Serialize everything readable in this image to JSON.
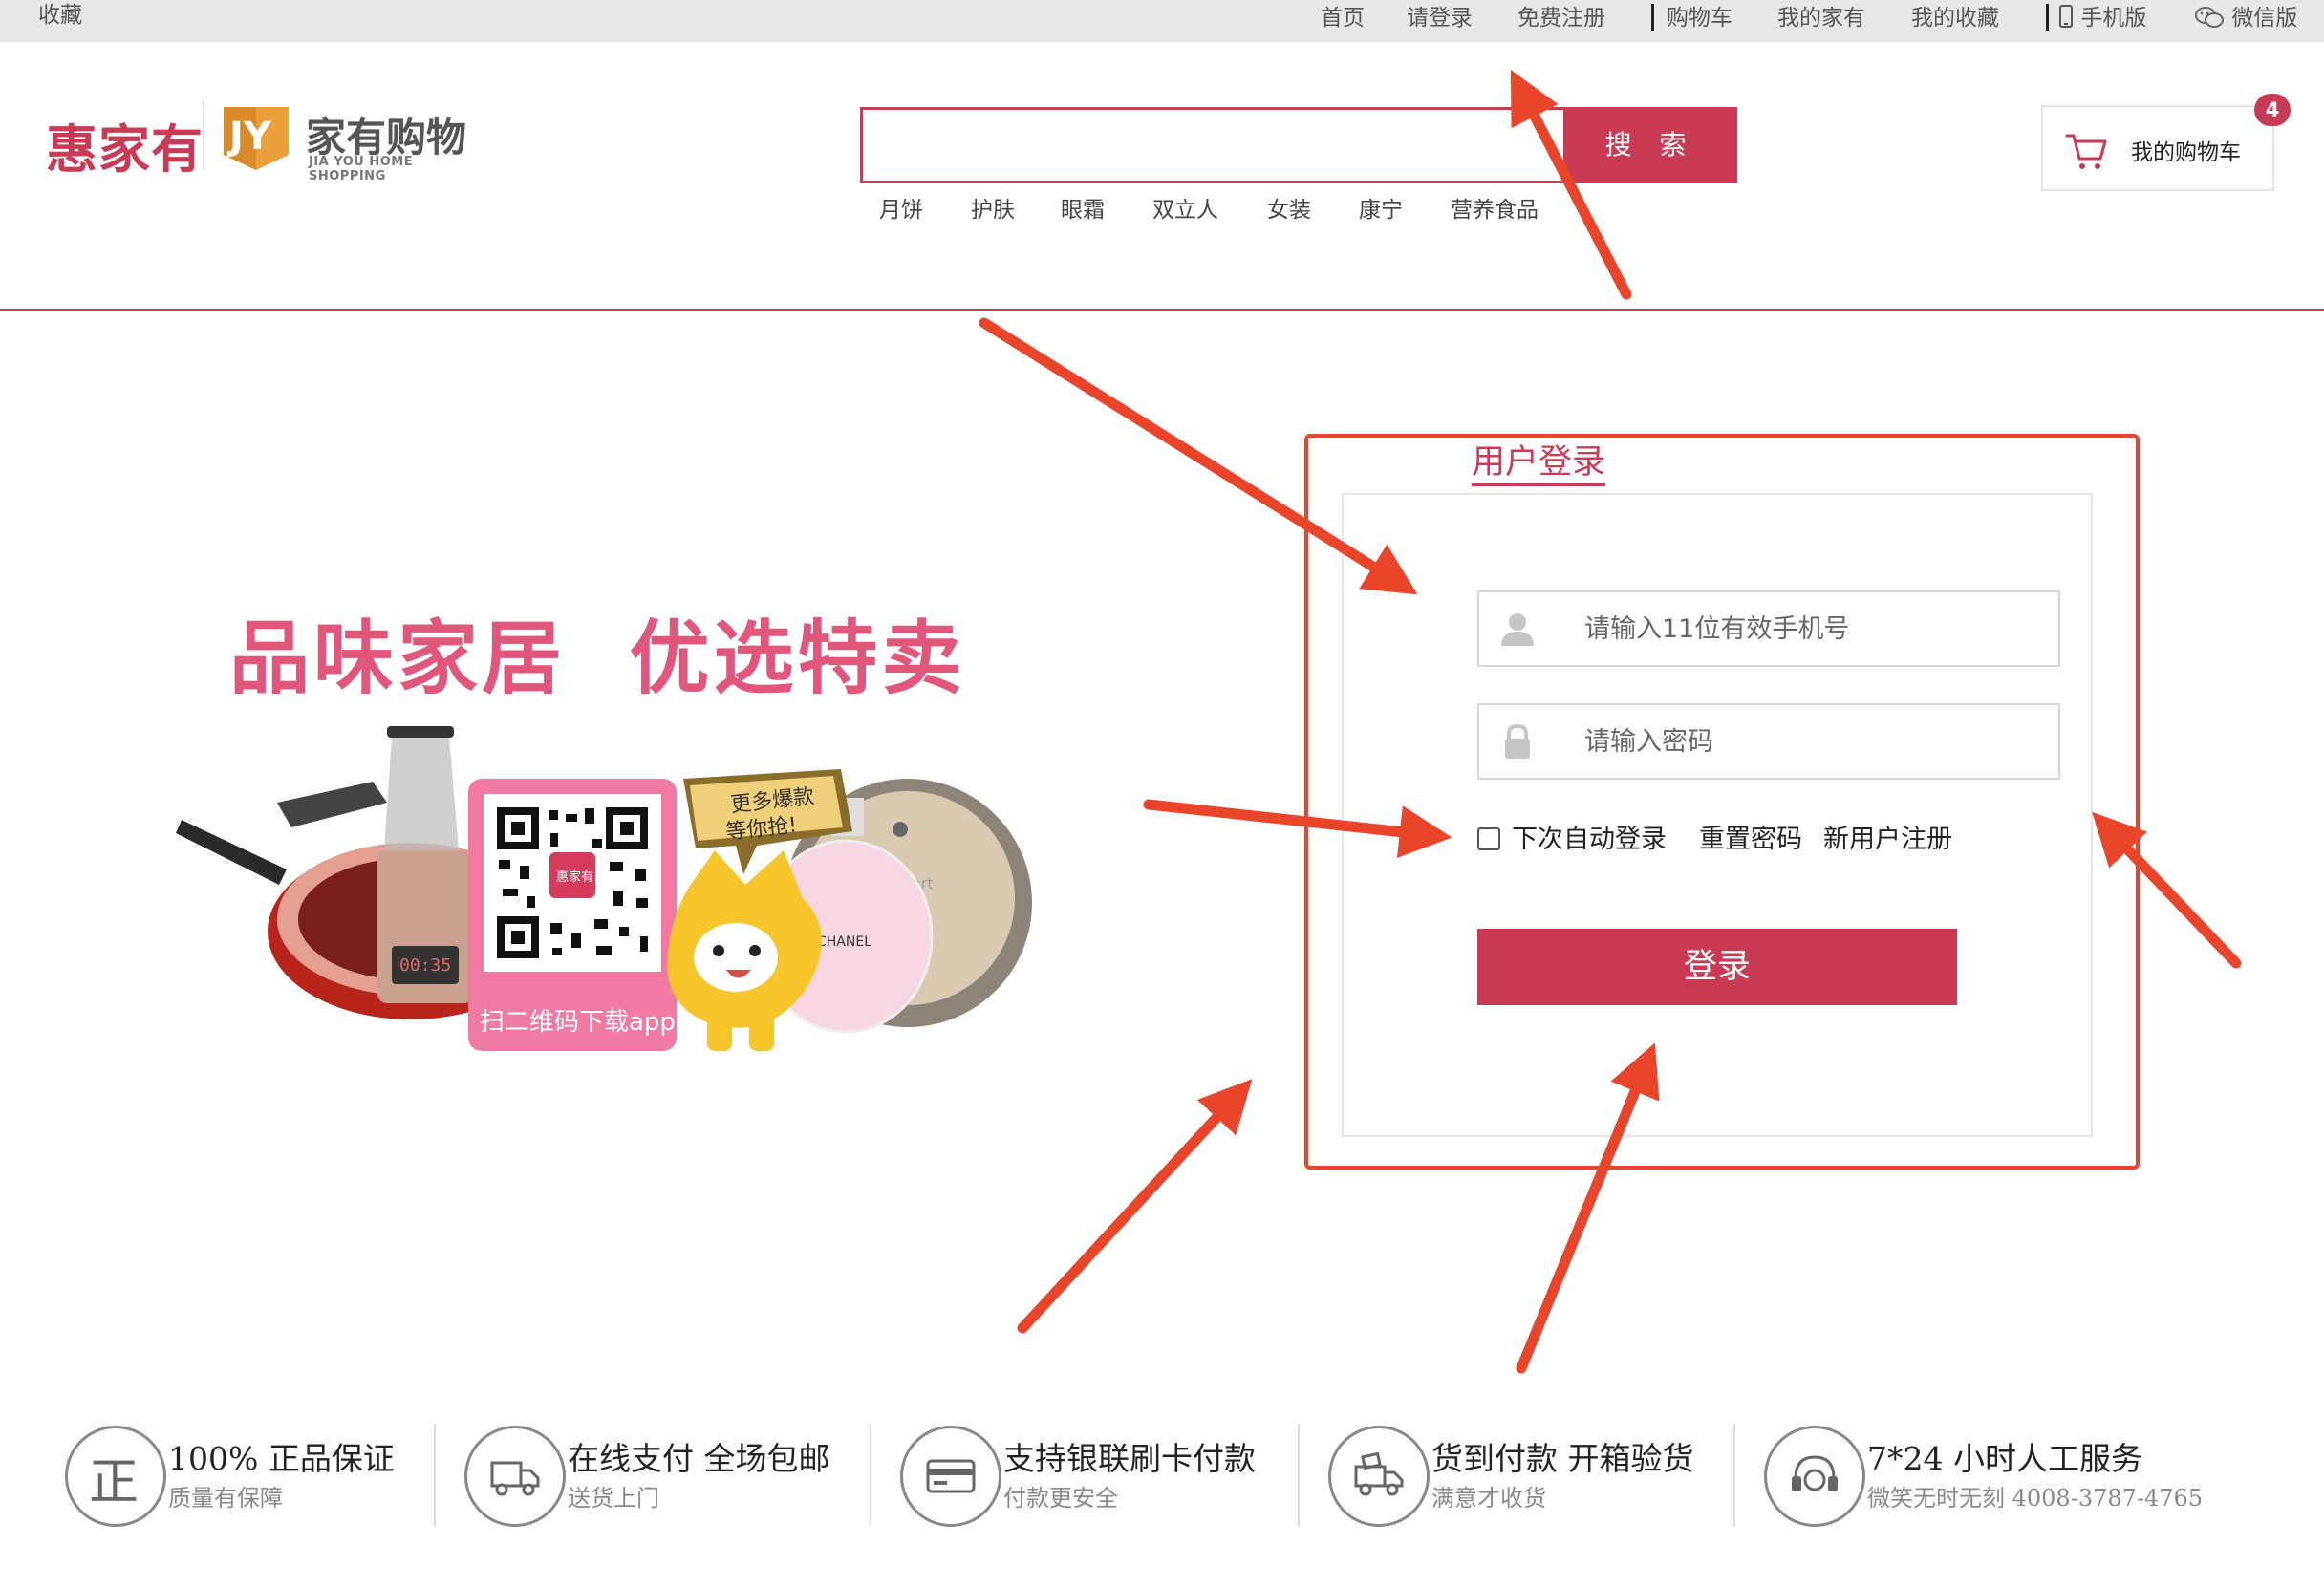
{
  "topbar": {
    "favorite": "收藏",
    "nav": [
      "首页",
      "请登录",
      "免费注册",
      "购物车",
      "我的家有",
      "我的收藏",
      "手机版",
      "微信版"
    ]
  },
  "header": {
    "logo_brand": "惠家有",
    "logo_partner_cn": "家有购物",
    "logo_partner_en": "JIA YOU HOME SHOPPING",
    "search_button": "搜 索",
    "hot_keywords": [
      "月饼",
      "护肤",
      "眼霜",
      "双立人",
      "女装",
      "康宁",
      "营养食品"
    ],
    "cart_label": "我的购物车",
    "cart_count": "4"
  },
  "promo": {
    "title": "品味家居  优选特卖",
    "bubble_line1": "更多爆款",
    "bubble_line2": "等你抢!",
    "qr_caption": "扫二维码下载app",
    "qr_brand": "惠家有",
    "bottle_text": "CHANEL",
    "device_text": "smart",
    "blender_display": "00:35"
  },
  "login": {
    "title": "用户登录",
    "phone_placeholder": "请输入11位有效手机号",
    "password_placeholder": "请输入密码",
    "auto_login": "下次自动登录",
    "reset_password": "重置密码",
    "register": "新用户注册",
    "submit": "登录"
  },
  "features": [
    {
      "icon": "genuine-icon",
      "icon_char": "正",
      "title": "100% 正品保证",
      "subtitle": "质量有保障"
    },
    {
      "icon": "delivery-truck-icon",
      "title": "在线支付 全场包邮",
      "subtitle": "送货上门"
    },
    {
      "icon": "bank-card-icon",
      "title": "支持银联刷卡付款",
      "subtitle": "付款更安全"
    },
    {
      "icon": "cash-on-delivery-icon",
      "title": "货到付款 开箱验货",
      "subtitle": "满意才收货"
    },
    {
      "icon": "headset-icon",
      "title": "7*24 小时人工服务",
      "subtitle": "微笑无时无刻 4008-3787-4765"
    }
  ],
  "colors": {
    "brand": "#c93a55",
    "annotation_arrow": "#e8452b",
    "promo_title": "#e0577b"
  }
}
